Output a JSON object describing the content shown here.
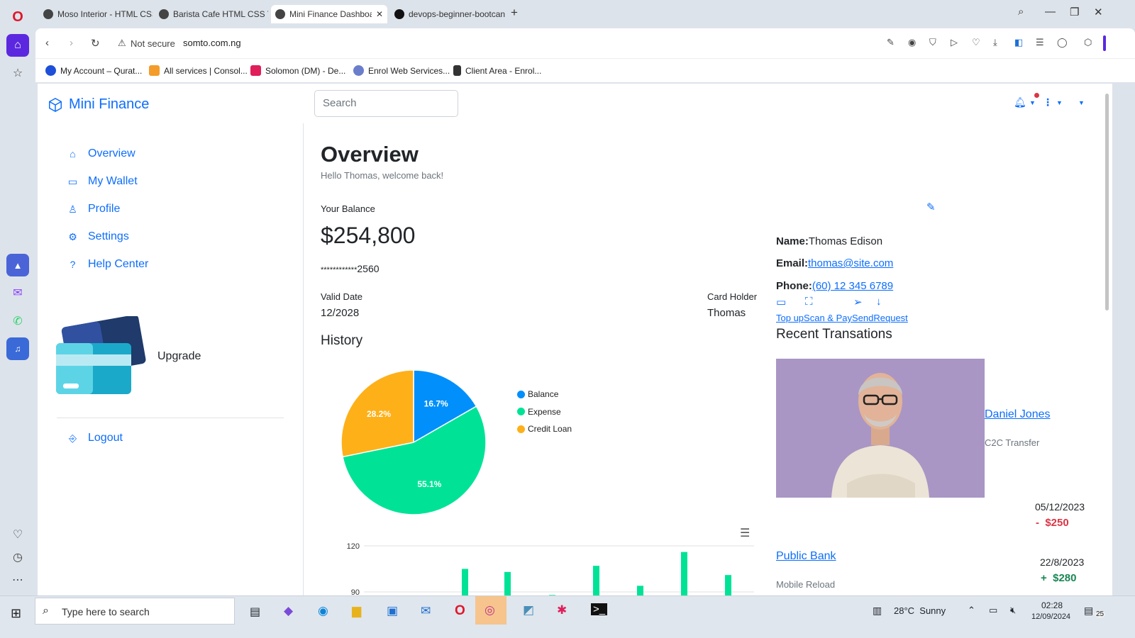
{
  "browser": {
    "tabs": [
      {
        "label": "Moso Interior - HTML CSS"
      },
      {
        "label": "Barista Cafe HTML CSS Te"
      },
      {
        "label": "Mini Finance Dashboa"
      },
      {
        "label": "devops-beginner-bootcan"
      }
    ],
    "security": "Not secure",
    "url": "somto.com.ng",
    "bookmarks": [
      {
        "label": "My Account – Qurat...",
        "color": "#1e4fd8"
      },
      {
        "label": "All services | Consol...",
        "color": "#f39c2a"
      },
      {
        "label": "Solomon (DM) - De...",
        "color": "#e01e5a"
      },
      {
        "label": "Enrol Web Services...",
        "color": "#6a7ecb"
      },
      {
        "label": "Client Area - Enrol...",
        "color": "#333333"
      }
    ]
  },
  "app": {
    "brand": "Mini Finance",
    "search_placeholder": "Search"
  },
  "sidebar": {
    "items": [
      {
        "label": "Overview",
        "icon": "home-icon"
      },
      {
        "label": "My Wallet",
        "icon": "wallet-icon"
      },
      {
        "label": "Profile",
        "icon": "person-icon"
      },
      {
        "label": "Settings",
        "icon": "gear-icon"
      },
      {
        "label": "Help Center",
        "icon": "question-icon"
      }
    ],
    "upgrade": "Upgrade",
    "logout": "Logout"
  },
  "overview": {
    "title": "Overview",
    "subtitle": "Hello Thomas, welcome back!",
    "balance_label": "Your Balance",
    "balance": "$254,800",
    "card_mask": "************",
    "card_last4": "2560",
    "valid_label": "Valid Date",
    "valid_value": "12/2028",
    "holder_label": "Card Holder",
    "holder_value": "Thomas",
    "history_title": "History"
  },
  "profile": {
    "name_label": "Name:",
    "name": "Thomas Edison",
    "email_label": "Email:",
    "email": "thomas@site.com",
    "phone_label": "Phone:",
    "phone": "(60) 12 345 6789",
    "actions": [
      {
        "label": "Top up",
        "icon": "wallet-icon"
      },
      {
        "label": "Scan & Pay",
        "icon": "scan-icon"
      },
      {
        "label": "Send",
        "icon": "send-icon"
      },
      {
        "label": "Request",
        "icon": "arrow-down-icon"
      }
    ]
  },
  "transactions": {
    "title": "Recent Transations",
    "items": [
      {
        "name": "Daniel Jones",
        "type": "C2C Transfer",
        "date": "05/12/2023",
        "sign": "-",
        "amount": "$250",
        "color": "#dc3545"
      },
      {
        "name": "Public Bank",
        "type": "Mobile Reload",
        "date": "22/8/2023",
        "sign": "+",
        "amount": "$280",
        "color": "#198754"
      }
    ]
  },
  "chart_data": [
    {
      "type": "pie",
      "categories": [
        "Balance",
        "Expense",
        "Credit Loan"
      ],
      "values": [
        16.7,
        55.1,
        28.2
      ],
      "labels": [
        "16.7%",
        "55.1%",
        "28.2%"
      ],
      "colors": [
        "#008ffb",
        "#00e396",
        "#feb019"
      ],
      "legend_position": "right"
    },
    {
      "type": "bar",
      "y_ticks": [
        "120",
        "90"
      ],
      "ylim": [
        60,
        120
      ],
      "values": [
        105,
        103,
        88,
        107,
        94,
        116,
        101
      ],
      "color": "#00e396"
    }
  ],
  "taskbar": {
    "search": "Type here to search",
    "weather": "28°C  Sunny",
    "time": "02:28",
    "date": "12/09/2024",
    "notif": "25"
  }
}
